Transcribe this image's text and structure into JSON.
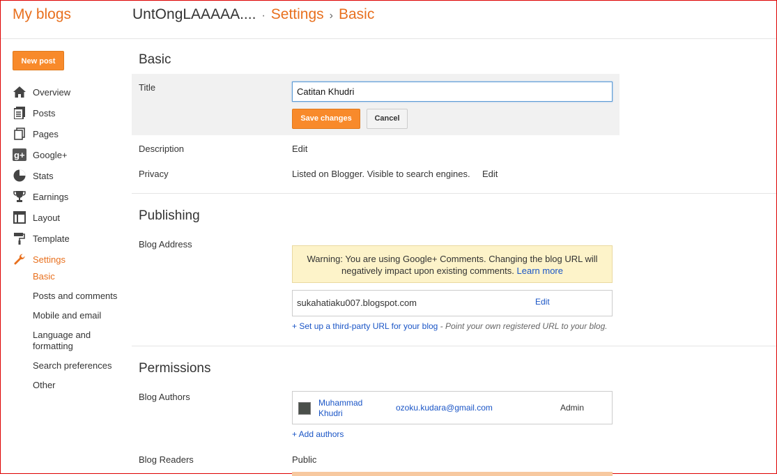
{
  "header": {
    "brand": "My blogs",
    "blog_title": "UntOngLAAAAA....",
    "sep1": "·",
    "crumb_settings": "Settings",
    "sep2": "›",
    "crumb_basic": "Basic"
  },
  "sidebar": {
    "new_post": "New post",
    "items": [
      {
        "label": "Overview",
        "icon": "home-icon"
      },
      {
        "label": "Posts",
        "icon": "posts-icon"
      },
      {
        "label": "Pages",
        "icon": "pages-icon"
      },
      {
        "label": "Google+",
        "icon": "google-plus-icon"
      },
      {
        "label": "Stats",
        "icon": "stats-icon"
      },
      {
        "label": "Earnings",
        "icon": "trophy-icon"
      },
      {
        "label": "Layout",
        "icon": "layout-icon"
      },
      {
        "label": "Template",
        "icon": "paint-roller-icon"
      },
      {
        "label": "Settings",
        "icon": "wrench-icon"
      }
    ],
    "subitems": [
      "Basic",
      "Posts and comments",
      "Mobile and email",
      "Language and formatting",
      "Search preferences",
      "Other"
    ]
  },
  "basic": {
    "section_title": "Basic",
    "title_label": "Title",
    "title_value": "Catitan Khudri",
    "save_label": "Save changes",
    "cancel_label": "Cancel",
    "description_label": "Description",
    "description_edit": "Edit",
    "privacy_label": "Privacy",
    "privacy_value": "Listed on Blogger. Visible to search engines.",
    "privacy_edit": "Edit"
  },
  "publishing": {
    "section_title": "Publishing",
    "address_label": "Blog Address",
    "warning_text": "Warning: You are using Google+ Comments. Changing the blog URL will negatively impact upon existing comments.",
    "learn_more": "Learn more",
    "address_value": "sukahatiaku007.blogspot.com",
    "address_edit": "Edit",
    "third_party_link": "+ Set up a third-party URL for your blog",
    "third_party_note": "- Point your own registered URL to your blog."
  },
  "permissions": {
    "section_title": "Permissions",
    "authors_label": "Blog Authors",
    "author_name": "Muhammad Khudri",
    "author_email": "ozoku.kudara@gmail.com",
    "author_role": "Admin",
    "add_authors": "+ Add authors",
    "readers_label": "Blog Readers",
    "readers_value": "Public"
  },
  "colors": {
    "accent": "#e8701e",
    "button": "#f88a2b",
    "link": "#1a55c6",
    "warning_bg": "#fdf3c9"
  }
}
